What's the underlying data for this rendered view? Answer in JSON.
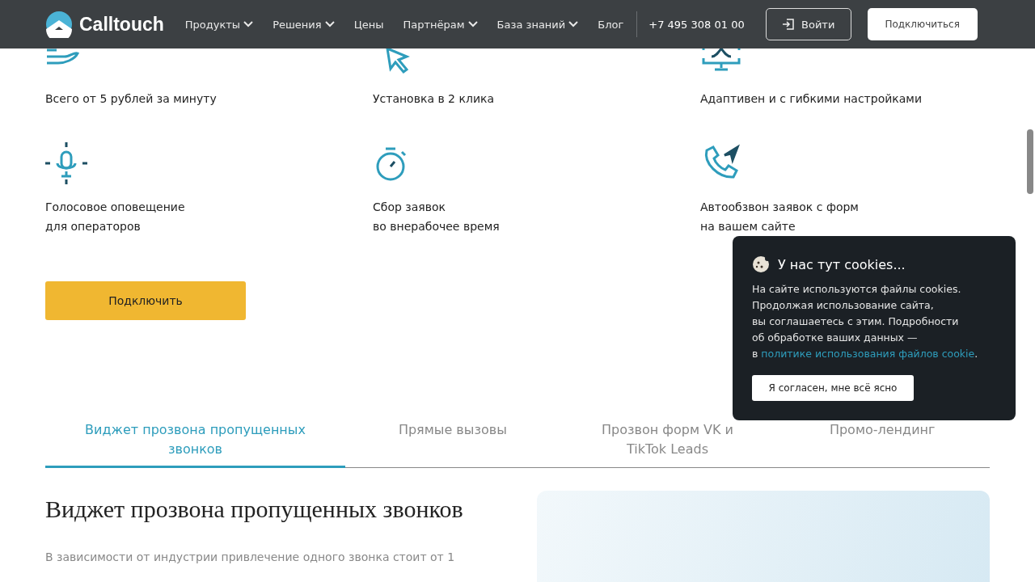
{
  "header": {
    "logo": "Calltouch",
    "nav": [
      {
        "label": "Продукты",
        "dropdown": true
      },
      {
        "label": "Решения",
        "dropdown": true
      },
      {
        "label": "Цены",
        "dropdown": false
      },
      {
        "label": "Партнёрам",
        "dropdown": true
      },
      {
        "label": "База знаний",
        "dropdown": true
      },
      {
        "label": "Блог",
        "dropdown": false
      }
    ],
    "phone": "+7 495 308 01 00",
    "login": "Войти",
    "connect": "Подключиться"
  },
  "features": [
    {
      "kind": "hand",
      "lines": [
        "Всего от 5 рублей за минуту"
      ]
    },
    {
      "kind": "cursor",
      "lines": [
        "Установка в 2 клика"
      ]
    },
    {
      "kind": "monitor",
      "lines": [
        "Адаптивен и с гибкими настройками"
      ]
    },
    {
      "kind": "mic",
      "lines": [
        "Голосовое оповещение",
        "для операторов"
      ]
    },
    {
      "kind": "stopwatch",
      "lines": [
        "Сбор заявок",
        "во внерабочее время"
      ]
    },
    {
      "kind": "phone",
      "lines": [
        "Автообзвон заявок с форм",
        "на вашем сайте"
      ]
    }
  ],
  "connect_button": "Подключить",
  "tabs": [
    {
      "label": "Виджет прозвона пропущенных звонков",
      "selected": true
    },
    {
      "label": "Прямые вызовы",
      "selected": false
    },
    {
      "label": "Прозвон форм VK и TikTok Leads",
      "selected": false
    },
    {
      "label": "Промо-лендинг",
      "selected": false
    }
  ],
  "section": {
    "title": "Виджет прозвона пропущенных звонков",
    "text": "В зависимости от индустрии привлечение одного звонка стоит от 1"
  },
  "cookie": {
    "title": "У нас тут cookies...",
    "lines": [
      "На сайте используются файлы cookies.",
      "Продолжая использование сайта,",
      "вы соглашаетесь с этим. Подробности",
      "об обработке ваших данных —"
    ],
    "link_prefix": "в",
    "link": "политике использования файлов cookie",
    "link_suffix": ".",
    "button": "Я согласен, мне всё ясно"
  }
}
